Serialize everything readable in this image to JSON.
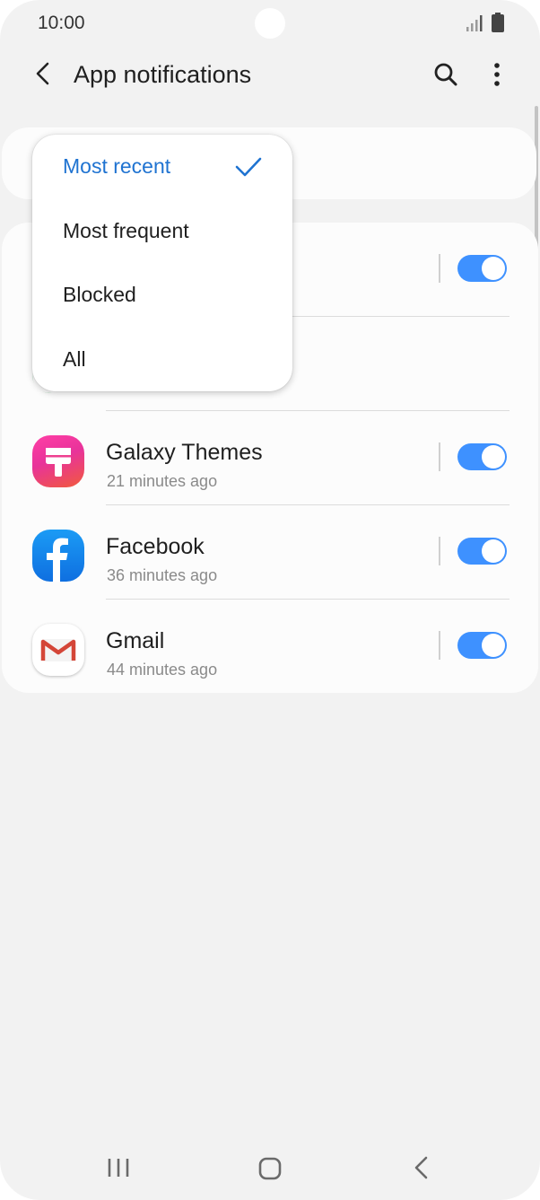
{
  "status_bar": {
    "time": "10:00"
  },
  "header": {
    "title": "App notifications"
  },
  "dropdown": {
    "options": [
      {
        "label": "Most recent",
        "selected": true
      },
      {
        "label": "Most frequent",
        "selected": false
      },
      {
        "label": "Blocked",
        "selected": false
      },
      {
        "label": "All",
        "selected": false
      }
    ]
  },
  "apps": [
    {
      "name": "",
      "time": "",
      "enabled": true
    },
    {
      "name": "",
      "time": "",
      "enabled": true
    },
    {
      "name": "Galaxy Themes",
      "time": "21 minutes ago",
      "enabled": true,
      "icon": "galaxy-themes-icon"
    },
    {
      "name": "Facebook",
      "time": "36 minutes ago",
      "enabled": true,
      "icon": "facebook-icon"
    },
    {
      "name": "Gmail",
      "time": "44 minutes ago",
      "enabled": true,
      "icon": "gmail-icon"
    }
  ],
  "colors": {
    "accent": "#1f73d1",
    "toggle_on": "#3e91ff",
    "background": "#f2f2f2",
    "card": "#fcfcfc"
  }
}
